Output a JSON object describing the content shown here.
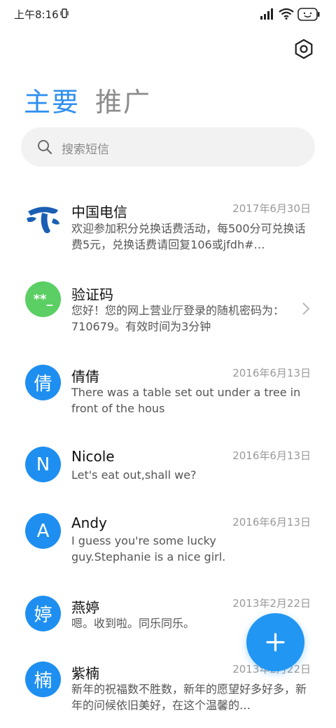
{
  "status_bar": {
    "time": "上午8:16",
    "icons": [
      "vibrate-icon",
      "signal-icon",
      "wifi-icon",
      "battery-icon"
    ]
  },
  "header": {
    "settings_icon": "settings-icon"
  },
  "tabs": [
    {
      "label": "主要",
      "active": true
    },
    {
      "label": "推广",
      "active": false
    }
  ],
  "search": {
    "placeholder": "搜索短信",
    "icon": "search-icon"
  },
  "threads": [
    {
      "name": "中国电信",
      "date": "2017年6月30日",
      "preview": "欢迎参加积分兑换话费活动，每500分可兑换话费5元，兑换话费请回复106或jfdh#…",
      "avatar": "china-telecom-logo"
    },
    {
      "name": "验证码",
      "date": "",
      "preview": "您好！您的网上营业厅登录的随机密码为：710679。有效时间为3分钟",
      "avatar_text": "**_"
    },
    {
      "name": "倩倩",
      "date": "2016年6月13日",
      "preview": "There was a table set out under a tree in front of the hous",
      "avatar_text": "倩"
    },
    {
      "name": "Nicole",
      "date": "2016年6月13日",
      "preview": "Let's eat out,shall we?",
      "avatar_text": "N"
    },
    {
      "name": "Andy",
      "date": "2016年6月13日",
      "preview": "I guess you're some lucky guy.Stephanie is a nice girl.",
      "avatar_text": "A"
    },
    {
      "name": "燕婷",
      "date": "2013年2月22日",
      "preview": "嗯。收到啦。同乐同乐。",
      "avatar_text": "婷"
    },
    {
      "name": "紫楠",
      "date": "2013年2月22日",
      "preview": "新年的祝福数不胜数，新年的愿望好多好多，新年的问候依旧美好，在这个温馨的…",
      "avatar_text": "楠"
    }
  ],
  "fab": {
    "icon": "plus-icon"
  },
  "colors": {
    "accent": "#2f8ff0",
    "avatar_blue": "#1e8ff0",
    "avatar_green": "#5bcf63",
    "fab": "#2196f3",
    "search_bg": "#f2f2f2"
  }
}
